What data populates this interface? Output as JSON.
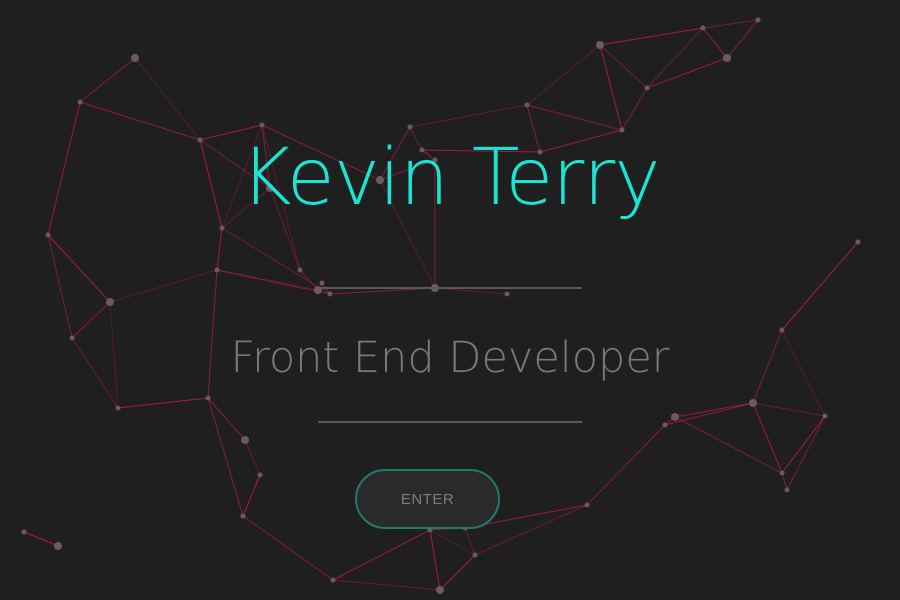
{
  "hero": {
    "name": "Kevin Terry",
    "role": "Front End Developer",
    "enter_label": "ENTER"
  },
  "colors": {
    "background": "#1f1f1f",
    "name": "#19e6d2",
    "role": "#7a7a7a",
    "divider": "#5a5a5a",
    "button_border": "#1f7a70",
    "network_line": "#c3184c",
    "network_node": "#6b5a62"
  }
}
